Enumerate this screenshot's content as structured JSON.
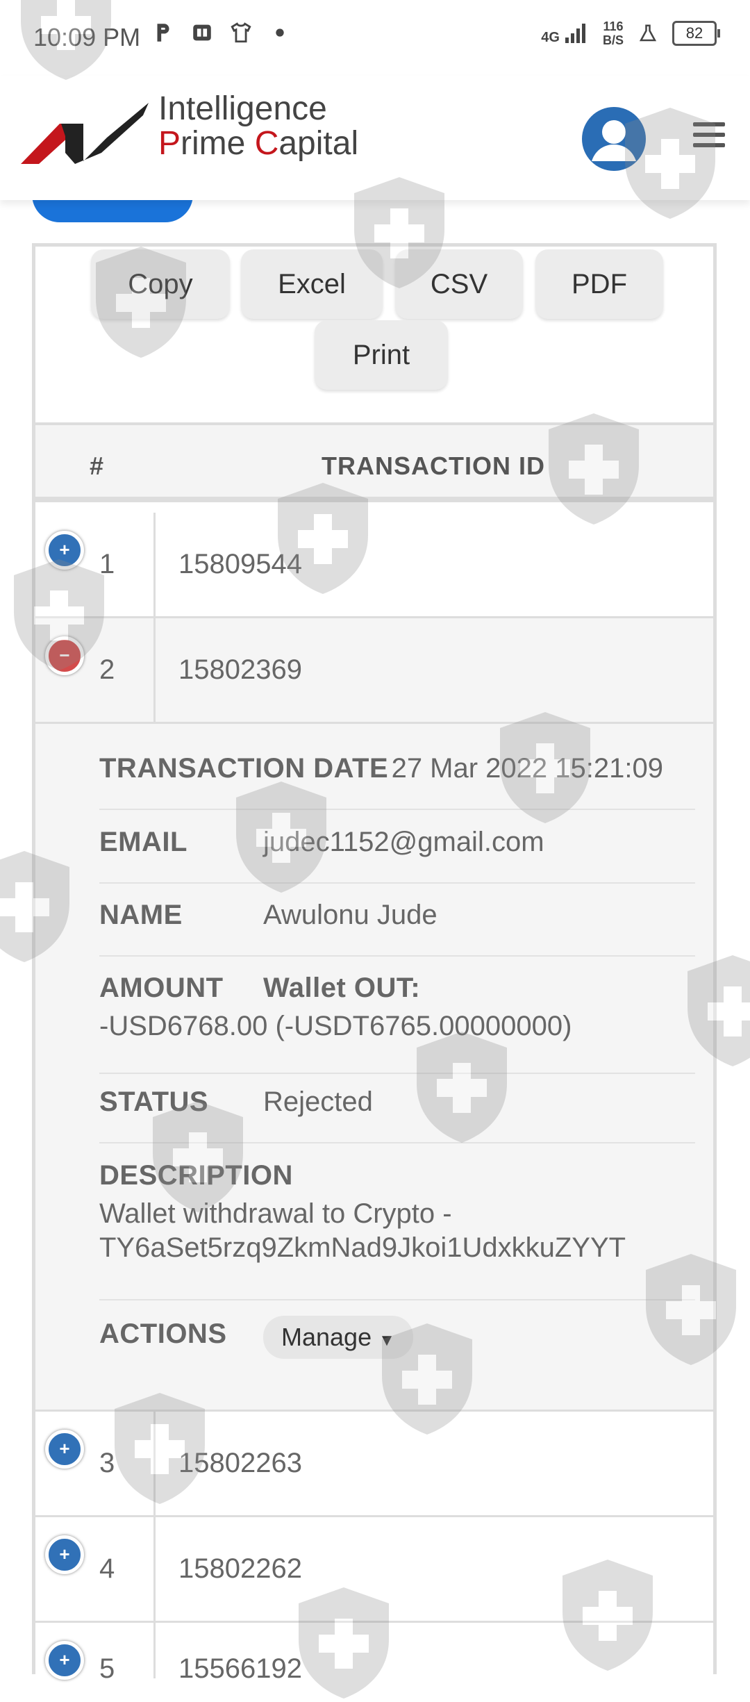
{
  "status_bar": {
    "time": "10:09 PM",
    "network": "4G",
    "speed_value": "116",
    "speed_unit": "B/S",
    "battery": "82"
  },
  "header": {
    "logo_line1": "Intelligence",
    "logo_line2_prefix": "",
    "logo_line2_rest": "rime ",
    "logo_line2_c": "C",
    "logo_line2_end": "apital",
    "logo_line2_p": "P"
  },
  "export_buttons": [
    "Copy",
    "Excel",
    "CSV",
    "PDF",
    "Print"
  ],
  "table": {
    "columns": [
      "#",
      "TRANSACTION ID"
    ],
    "rows": [
      {
        "num": "1",
        "id": "15809544",
        "expanded": false
      },
      {
        "num": "2",
        "id": "15802369",
        "expanded": true
      },
      {
        "num": "3",
        "id": "15802263",
        "expanded": false
      },
      {
        "num": "4",
        "id": "15802262",
        "expanded": false
      },
      {
        "num": "5",
        "id": "15566192",
        "expanded": false
      }
    ]
  },
  "detail": {
    "date_label": "TRANSACTION DATE",
    "date_value": "27 Mar 2022 15:21:09",
    "email_label": "EMAIL",
    "email_value": "judec1152@gmail.com",
    "name_label": "NAME",
    "name_value": "Awulonu Jude",
    "amount_label": "AMOUNT",
    "amount_wallet": "Wallet OUT:",
    "amount_value": "-USD6768.00 (-USDT6765.00000000)",
    "status_label": "STATUS",
    "status_value": "Rejected",
    "description_label": "DESCRIPTION",
    "description_line1": "Wallet withdrawal to Crypto -",
    "description_line2": "TY6aSet5rzq9ZkmNad9Jkoi1UdxkkuZYYT",
    "actions_label": "ACTIONS",
    "manage_label": "Manage"
  },
  "colors": {
    "brand_red": "#c4161c",
    "accent_blue": "#1a73d9",
    "expand_blue": "#3171b7",
    "collapse_red": "#d34b4b"
  }
}
